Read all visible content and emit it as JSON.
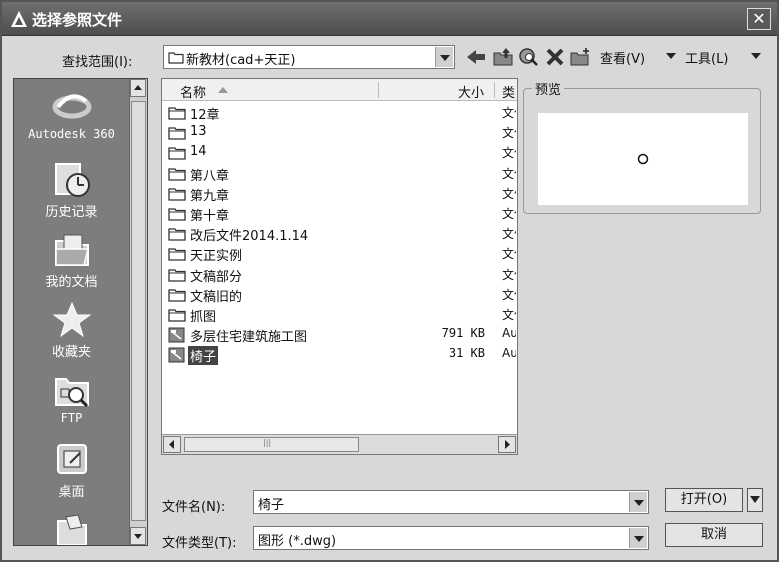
{
  "window": {
    "title": "选择参照文件",
    "close_glyph": "✕"
  },
  "lookin": {
    "label": "查找范围(I):",
    "folder": "新教材(cad+天正)"
  },
  "toolbar": {
    "icons": [
      "back-icon",
      "up-folder-icon",
      "search-web-icon",
      "delete-icon",
      "new-folder-icon"
    ],
    "views_label": "查看(V)",
    "tools_label": "工具(L)"
  },
  "places": [
    {
      "label": "Autodesk 360",
      "icon": "autodesk-360-icon"
    },
    {
      "label": "历史记录",
      "icon": "history-icon"
    },
    {
      "label": "我的文档",
      "icon": "my-documents-icon"
    },
    {
      "label": "收藏夹",
      "icon": "favorites-icon"
    },
    {
      "label": "FTP",
      "icon": "ftp-icon"
    },
    {
      "label": "桌面",
      "icon": "desktop-icon"
    }
  ],
  "filelist": {
    "columns": {
      "name": "名称",
      "size": "大小",
      "type": "类"
    },
    "rows": [
      {
        "name": "12章",
        "size": "",
        "type": "文件夹",
        "kind": "folder"
      },
      {
        "name": "13",
        "size": "",
        "type": "文件夹",
        "kind": "folder"
      },
      {
        "name": "14",
        "size": "",
        "type": "文件夹",
        "kind": "folder"
      },
      {
        "name": "第八章",
        "size": "",
        "type": "文件夹",
        "kind": "folder"
      },
      {
        "name": "第九章",
        "size": "",
        "type": "文件夹",
        "kind": "folder"
      },
      {
        "name": "第十章",
        "size": "",
        "type": "文件夹",
        "kind": "folder"
      },
      {
        "name": "改后文件2014.1.14",
        "size": "",
        "type": "文件夹",
        "kind": "folder"
      },
      {
        "name": "天正实例",
        "size": "",
        "type": "文件夹",
        "kind": "folder"
      },
      {
        "name": "文稿部分",
        "size": "",
        "type": "文件夹",
        "kind": "folder"
      },
      {
        "name": "文稿旧的",
        "size": "",
        "type": "文件夹",
        "kind": "folder"
      },
      {
        "name": "抓图",
        "size": "",
        "type": "文件夹",
        "kind": "folder"
      },
      {
        "name": "多层住宅建筑施工图",
        "size": "791 KB",
        "type": "AutoCAD",
        "kind": "dwg"
      },
      {
        "name": "椅子",
        "size": "31 KB",
        "type": "AutoCAD",
        "kind": "dwg",
        "selected": true
      }
    ],
    "hscroll_grip": "|||"
  },
  "preview": {
    "label": "预览"
  },
  "filename": {
    "label": "文件名(N):",
    "value": "椅子"
  },
  "filetype": {
    "label": "文件类型(T):",
    "value": "图形 (*.dwg)"
  },
  "buttons": {
    "open": "打开(O)",
    "cancel": "取消"
  }
}
